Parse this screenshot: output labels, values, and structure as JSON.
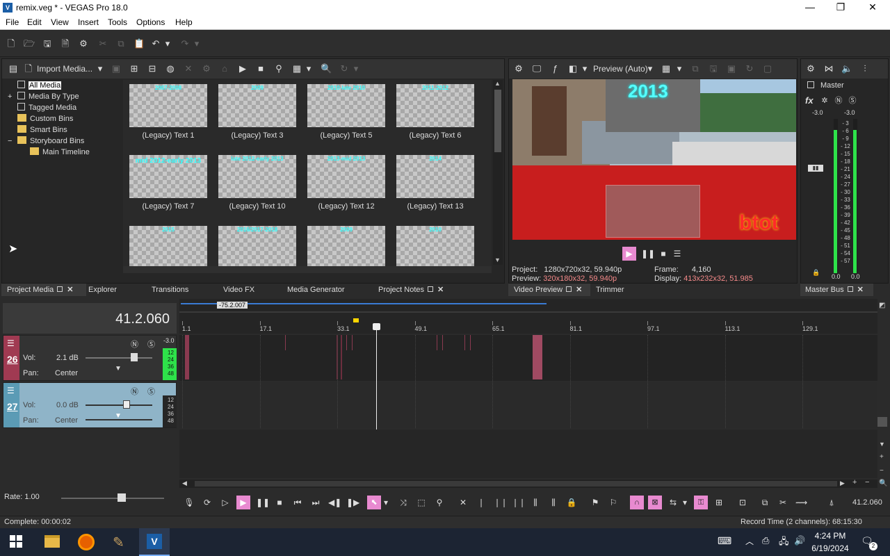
{
  "window": {
    "title": "remix.veg * - VEGAS Pro 18.0",
    "minimize": "—",
    "maximize": "❐",
    "close": "✕",
    "app_icon": "V"
  },
  "menu": [
    "File",
    "Edit",
    "View",
    "Insert",
    "Tools",
    "Options",
    "Help"
  ],
  "media_toolbar": {
    "import_label": "Import Media..."
  },
  "tree": {
    "items": [
      {
        "label": "All Media",
        "expander": ""
      },
      {
        "label": "Media By Type",
        "expander": "+"
      },
      {
        "label": "Tagged Media",
        "expander": ""
      },
      {
        "label": "Custom Bins",
        "expander": ""
      },
      {
        "label": "Smart Bins",
        "expander": ""
      },
      {
        "label": "Storyboard Bins",
        "expander": "−"
      },
      {
        "label": "Main Timeline",
        "expander": ""
      }
    ]
  },
  "media_thumbs": [
    {
      "overlay": "2007-2008",
      "label": "(Legacy) Text 1"
    },
    {
      "overlay": "2009",
      "label": "(Legacy) Text 3"
    },
    {
      "overlay": "2010-late 2010",
      "label": "(Legacy) Text 5"
    },
    {
      "overlay": "2011-2012",
      "label": "(Legacy) Text 6"
    },
    {
      "overlay": "mid 2012-early 2013",
      "label": "(Legacy) Text 7"
    },
    {
      "overlay": "late 2012-early 2013",
      "label": "(Legacy) Text 10"
    },
    {
      "overlay": "2013-mid 2013",
      "label": "(Legacy) Text 12"
    },
    {
      "overlay": "2014",
      "label": "(Legacy) Text 13"
    },
    {
      "overlay": "2015",
      "label": ""
    },
    {
      "overlay": "2016/2017-2018",
      "label": ""
    },
    {
      "overlay": "2009",
      "label": ""
    },
    {
      "overlay": "2010",
      "label": ""
    }
  ],
  "left_tabs": {
    "project_media": "Project Media",
    "explorer": "Explorer",
    "transitions": "Transitions",
    "video_fx": "Video FX",
    "media_generator": "Media Generator",
    "project_notes": "Project Notes"
  },
  "preview": {
    "quality": "Preview (Auto)",
    "overlay_year": "2013",
    "overlay_text": "btot",
    "project_label": "Project:",
    "project_value": "1280x720x32, 59.940p",
    "preview_label": "Preview:",
    "preview_value": "320x180x32, 59.940p",
    "frame_label": "Frame:",
    "frame_value": "4,160",
    "display_label": "Display:",
    "display_value": "413x232x32, 51.985",
    "tab_video_preview": "Video Preview",
    "tab_trimmer": "Trimmer"
  },
  "master": {
    "title": "Master",
    "fx": "fx",
    "peak_left": "-3.0",
    "peak_right": "-3.0",
    "scale": [
      "3",
      "6",
      "9",
      "12",
      "15",
      "18",
      "21",
      "24",
      "27",
      "30",
      "33",
      "36",
      "39",
      "42",
      "45",
      "48",
      "51",
      "54",
      "57"
    ],
    "bottom_left": "0.0",
    "bottom_right": "0.0",
    "level_left": 0.93,
    "level_right": 0.93,
    "tab": "Master Bus"
  },
  "timeline": {
    "time_display": "41.2.060",
    "region_label": "-75.2.007",
    "ruler": [
      "1.1",
      "17.1",
      "33.1",
      "49.1",
      "65.1",
      "81.1",
      "97.1",
      "113.1",
      "129.1"
    ],
    "tracks": [
      {
        "number": "26",
        "vol_label": "Vol:",
        "vol_value": "2.1 dB",
        "pan_label": "Pan:",
        "pan_value": "Center",
        "meter_top": "-3.0",
        "meter_scale": [
          "12",
          "24",
          "36",
          "48"
        ],
        "color": "#a03a52"
      },
      {
        "number": "27",
        "vol_label": "Vol:",
        "vol_value": "0.0 dB",
        "pan_label": "Pan:",
        "pan_value": "Center",
        "meter_top": "",
        "meter_scale": [
          "12",
          "24",
          "36",
          "48"
        ],
        "color": "#5b9bb5"
      }
    ],
    "rate_label": "Rate: 1.00",
    "end_time": "41.2.060"
  },
  "status": {
    "left": "Complete: 00:00:02",
    "right": "Record Time (2 channels): 68:15:30"
  },
  "taskbar": {
    "time": "4:24 PM",
    "date": "6/19/2024",
    "notifications": "2"
  }
}
